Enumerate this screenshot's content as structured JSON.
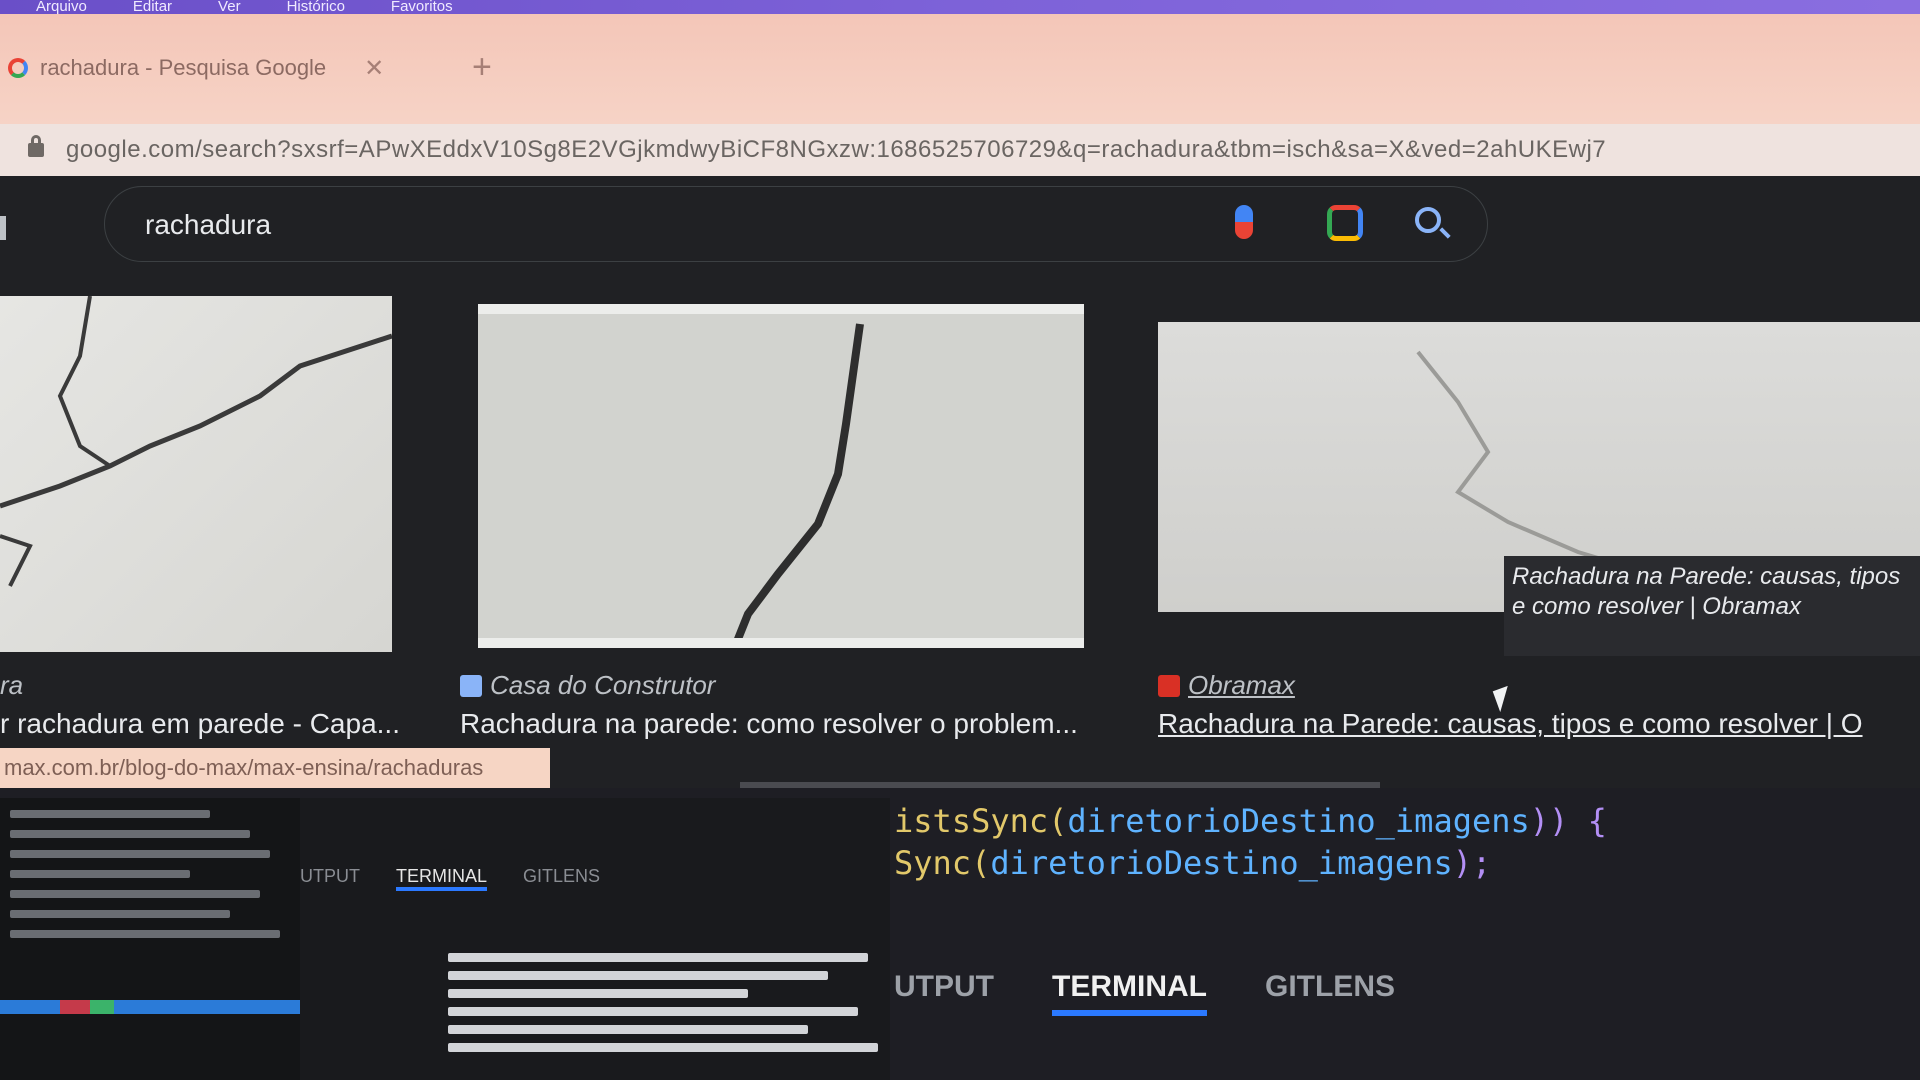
{
  "menu": {
    "items": [
      "Arquivo",
      "Editar",
      "Ver",
      "Histórico",
      "Favoritos"
    ]
  },
  "browser": {
    "tab_title": "rachadura - Pesquisa Google",
    "tab_close": "✕",
    "new_tab": "+",
    "url": "google.com/search?sxsrf=APwXEddxV10Sg8E2VGjkmdwyBiCF8NGxzw:1686525706729&q=rachadura&tbm=isch&sa=X&ved=2ahUKEwj7"
  },
  "search": {
    "query": "rachadura"
  },
  "results": [
    {
      "source": "ra",
      "title": "r rachadura em parede - Capa..."
    },
    {
      "source": "Casa do Construtor",
      "title": "Rachadura na parede: como resolver o problem..."
    },
    {
      "source": "Obramax",
      "title": "Rachadura na Parede: causas, tipos e como resolver | O"
    }
  ],
  "tooltip": "Rachadura na Parede: causas, tipos e como resolver | Obramax",
  "status_url": "max.com.br/blog-do-max/max-ensina/rachaduras",
  "editor": {
    "line1_fn": "istsSync(",
    "line1_var": "diretorioDestino_imagens",
    "line1_end": ")) {",
    "line2_fn": "Sync(",
    "line2_var": "diretorioDestino_imagens",
    "line2_end": ");"
  },
  "panel": {
    "tabs": [
      "UTPUT",
      "TERMINAL",
      "GITLENS"
    ]
  },
  "mini_panel": {
    "tabs": [
      "UTPUT",
      "TERMINAL",
      "GITLENS"
    ]
  },
  "colors": {
    "accent": "#2b79ff",
    "code_function": "#e2c86a",
    "code_variable": "#5fb3ff"
  }
}
